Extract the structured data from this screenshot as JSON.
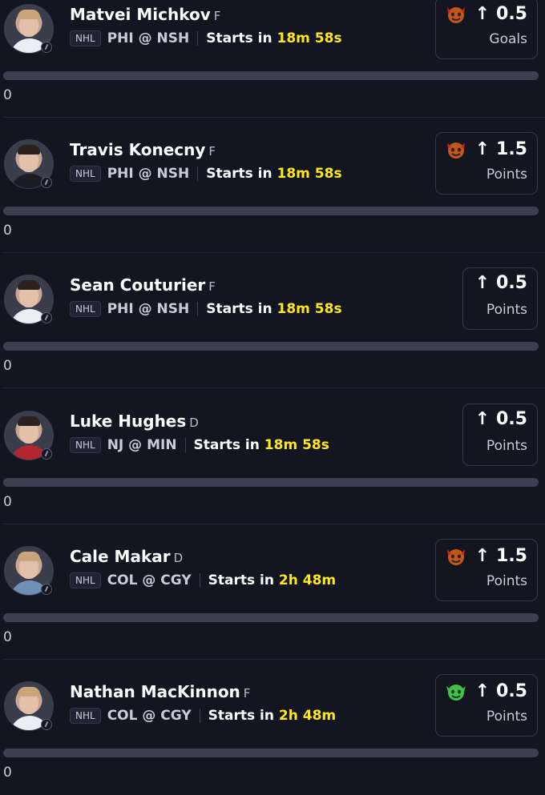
{
  "players": [
    {
      "name": "Matvei Michkov",
      "pos": "F",
      "league": "NHL",
      "matchup": "PHI @ NSH",
      "starts_label": "Starts in",
      "starts_time": "18m 58s",
      "prop_value": "0.5",
      "prop_stat": "Goals",
      "emoji": "devil-icon",
      "progress": "0",
      "progress_fraction": 0
    },
    {
      "name": "Travis Konecny",
      "pos": "F",
      "league": "NHL",
      "matchup": "PHI @ NSH",
      "starts_label": "Starts in",
      "starts_time": "18m 58s",
      "prop_value": "1.5",
      "prop_stat": "Points",
      "emoji": "devil-icon",
      "progress": "0",
      "progress_fraction": 0
    },
    {
      "name": "Sean Couturier",
      "pos": "F",
      "league": "NHL",
      "matchup": "PHI @ NSH",
      "starts_label": "Starts in",
      "starts_time": "18m 58s",
      "prop_value": "0.5",
      "prop_stat": "Points",
      "emoji": "",
      "progress": "0",
      "progress_fraction": 0
    },
    {
      "name": "Luke Hughes",
      "pos": "D",
      "league": "NHL",
      "matchup": "NJ @ MIN",
      "starts_label": "Starts in",
      "starts_time": "18m 58s",
      "prop_value": "0.5",
      "prop_stat": "Points",
      "emoji": "",
      "progress": "0",
      "progress_fraction": 0
    },
    {
      "name": "Cale Makar",
      "pos": "D",
      "league": "NHL",
      "matchup": "COL @ CGY",
      "starts_label": "Starts in",
      "starts_time": "2h 48m",
      "prop_value": "1.5",
      "prop_stat": "Points",
      "emoji": "devil-icon",
      "progress": "0",
      "progress_fraction": 0
    },
    {
      "name": "Nathan MacKinnon",
      "pos": "F",
      "league": "NHL",
      "matchup": "COL @ CGY",
      "starts_label": "Starts in",
      "starts_time": "2h 48m",
      "prop_value": "0.5",
      "prop_stat": "Points",
      "emoji": "goblin-icon",
      "progress": "0",
      "progress_fraction": 0
    }
  ],
  "colors": {
    "background": "#131520",
    "accent": "#ffe81a",
    "bar": "#3c3f4f"
  }
}
